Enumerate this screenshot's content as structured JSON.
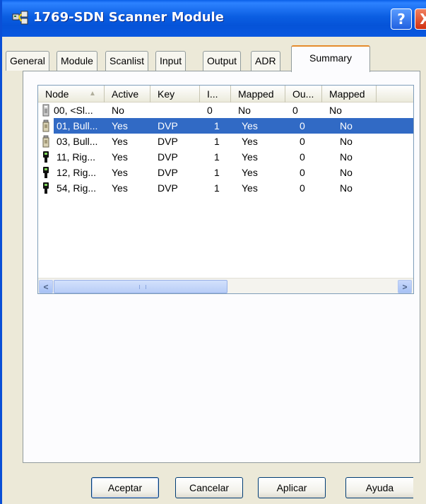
{
  "window": {
    "title": "1769-SDN Scanner Module",
    "help_label": "?",
    "close_label": "X"
  },
  "tabs": [
    {
      "label": "General"
    },
    {
      "label": "Module"
    },
    {
      "label": "Scanlist"
    },
    {
      "label": "Input"
    },
    {
      "label": "Output"
    },
    {
      "label": "ADR"
    },
    {
      "label": "Summary",
      "active": true
    }
  ],
  "table": {
    "columns": [
      "Node",
      "Active",
      "Key",
      "I...",
      "Mapped",
      "Ou...",
      "Mapped"
    ],
    "sort_column": "Node",
    "rows": [
      {
        "icon": "scanner-device-icon",
        "cells": [
          "00, <Sl...",
          "No",
          "",
          "0",
          "No",
          "0",
          "No"
        ]
      },
      {
        "icon": "bulletin-device-icon",
        "selected": true,
        "cells": [
          "01, Bull...",
          "Yes",
          "DVP",
          "1",
          "Yes",
          "0",
          "No"
        ]
      },
      {
        "icon": "bulletin-device-icon",
        "cells": [
          "03, Bull...",
          "Yes",
          "DVP",
          "1",
          "Yes",
          "0",
          "No"
        ]
      },
      {
        "icon": "rig-device-icon",
        "cells": [
          "11, Rig...",
          "Yes",
          "DVP",
          "1",
          "Yes",
          "0",
          "No"
        ]
      },
      {
        "icon": "rig-device-icon",
        "cells": [
          "12, Rig...",
          "Yes",
          "DVP",
          "1",
          "Yes",
          "0",
          "No"
        ]
      },
      {
        "icon": "rig-device-icon",
        "cells": [
          "54, Rig...",
          "Yes",
          "DVP",
          "1",
          "Yes",
          "0",
          "No"
        ]
      }
    ]
  },
  "scrollbar": {
    "left_arrow": "<",
    "right_arrow": ">"
  },
  "buttons": {
    "ok": "Aceptar",
    "cancel": "Cancelar",
    "apply": "Aplicar",
    "help": "Ayuda"
  },
  "colors": {
    "titlebar": "#0a5fe8",
    "selection": "#316ac5",
    "active_tab_accent": "#e68b2c",
    "close_button": "#d03010"
  }
}
